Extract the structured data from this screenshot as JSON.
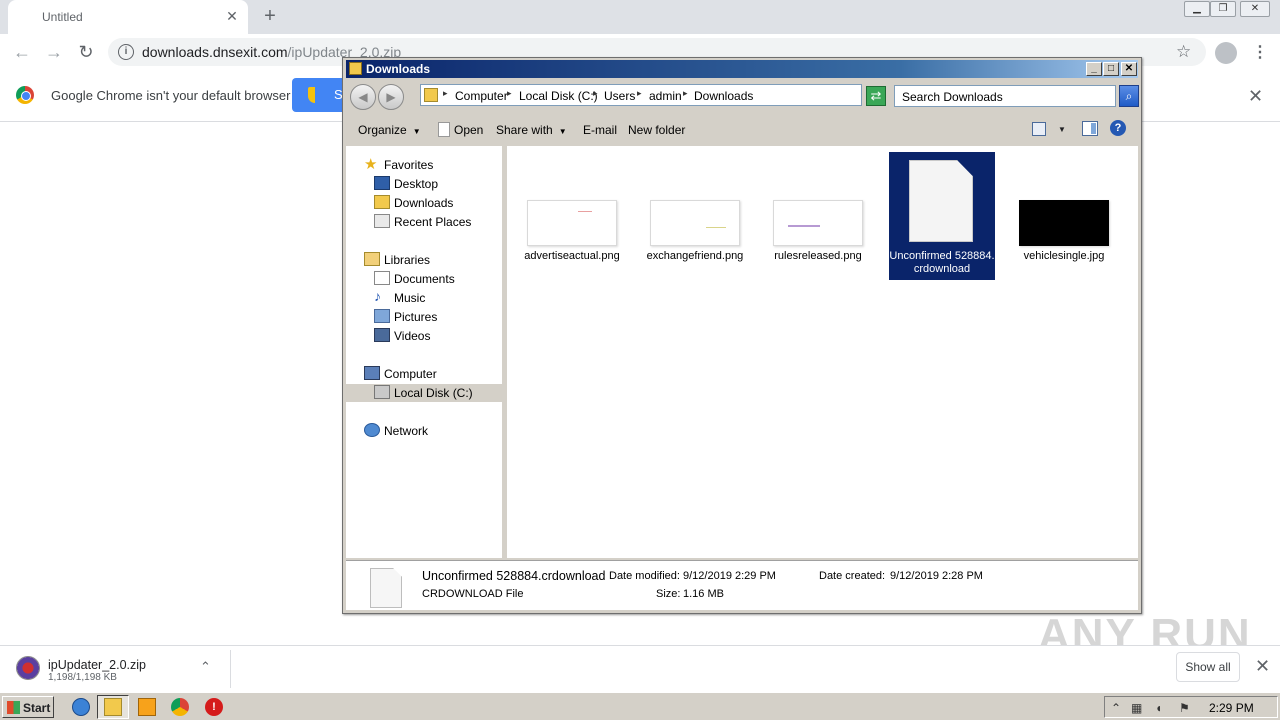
{
  "browser": {
    "tab_title": "Untitled",
    "url_host": "downloads.dnsexit.com",
    "url_path": "/ipUpdater_2.0.zip",
    "infobar_text": "Google Chrome isn't your default browser",
    "infobar_button": "S"
  },
  "explorer": {
    "title": "Downloads",
    "breadcrumbs": [
      "Computer",
      "Local Disk (C:)",
      "Users",
      "admin",
      "Downloads"
    ],
    "search_placeholder": "Search Downloads",
    "commands": {
      "organize": "Organize",
      "open": "Open",
      "share_with": "Share with",
      "email": "E-mail",
      "new_folder": "New folder"
    },
    "nav": {
      "favorites": "Favorites",
      "desktop": "Desktop",
      "downloads": "Downloads",
      "recent": "Recent Places",
      "libraries": "Libraries",
      "documents": "Documents",
      "music": "Music",
      "pictures": "Pictures",
      "videos": "Videos",
      "computer": "Computer",
      "local_disk": "Local Disk (C:)",
      "network": "Network"
    },
    "files": [
      {
        "name": "advertiseactual.png"
      },
      {
        "name": "exchangefriend.png"
      },
      {
        "name": "rulesreleased.png"
      },
      {
        "name": "Unconfirmed 528884.crdownload"
      },
      {
        "name": "vehiclesingle.jpg"
      }
    ],
    "details": {
      "name": "Unconfirmed 528884.crdownload",
      "type": "CRDOWNLOAD File",
      "modified_label": "Date modified:",
      "modified": "9/12/2019 2:29 PM",
      "created_label": "Date created:",
      "created": "9/12/2019 2:28 PM",
      "size_label": "Size:",
      "size": "1.16 MB"
    }
  },
  "download_shelf": {
    "file": "ipUpdater_2.0.zip",
    "progress": "1,198/1,198 KB",
    "show_all": "Show all"
  },
  "watermark": "ANY RUN",
  "taskbar": {
    "start": "Start",
    "clock": "2:29 PM"
  }
}
